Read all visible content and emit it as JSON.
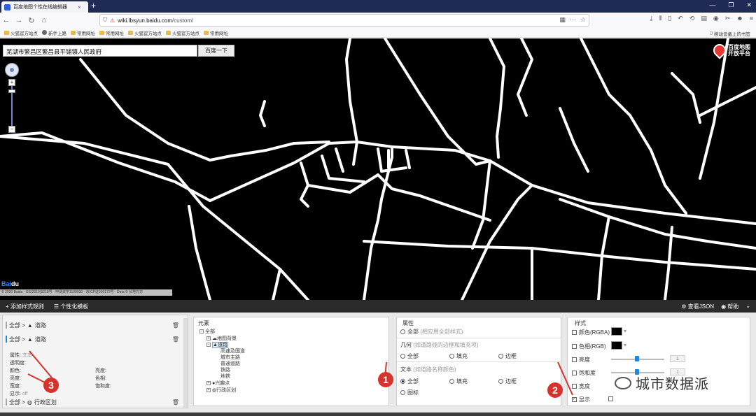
{
  "browser": {
    "tab_title": "百度地图个性在线编辑器",
    "tab_close": "×",
    "new_tab": "+",
    "url_domain": "wiki.lbsyun.baidu.com",
    "url_path": "/custom/",
    "bookmarks": [
      "火狐官方站点",
      "新手上路",
      "常用网址",
      "常用网址",
      "火狐官方站点",
      "火狐官方站点",
      "常用网址"
    ],
    "mobile_bookmarks": "移动设备上的书签"
  },
  "map": {
    "search_value": "芜湖市繁昌区繁昌县平铺镇人民政府",
    "search_button": "百度一下",
    "logo_line1": "百度地图",
    "logo_line2": "开放平台",
    "zoom_in": "+",
    "zoom_out": "−",
    "baidu_logo_a": "Bai",
    "baidu_logo_b": "du",
    "copyright": "© 2020 Baidu - GS(2019)5218号 - 甲测资字1100930 - 京ICP证030173号 - Data © 长地万方"
  },
  "toolbar": {
    "add_rule": "+ 添加样式规则",
    "template": "☰ 个性化模板",
    "view_json": "⚙ 查看JSON",
    "help": "◉ 帮助",
    "collapse": "⌄"
  },
  "rules_panel": {
    "rule1_path": "全部 > ",
    "rule1_name": "道路",
    "rule2_path": "全部 > ",
    "rule2_name": "道路",
    "rule3_path": "全部 > ",
    "rule3_name": "行政区划",
    "props_label": "属性:",
    "props_value": "文本",
    "opacity": "透明度:",
    "color": "颜色:",
    "brightness_l": "亮度:",
    "width": "宽度:",
    "display": "显示:",
    "display_value": "off",
    "brightness": "亮度:",
    "hue": "色相:",
    "saturation": "饱和度:"
  },
  "elements_panel": {
    "header": "元素",
    "root": "全部",
    "items": [
      "地图背景",
      "道路",
      "高速及国道",
      "城市主路",
      "普通道路",
      "铁路",
      "地铁",
      "兴趣点",
      "行政区划"
    ]
  },
  "attrs_panel": {
    "header": "属性",
    "all": "全部",
    "all_desc": "(相应用全部样式)",
    "geom_label": "几何",
    "geom_desc": "(如道路线的边框和填充项)",
    "geom_opts": [
      "全部",
      "填充",
      "边框"
    ],
    "text_label": "文本",
    "text_desc": "(如道路名称颜色)",
    "text_opts": [
      "全部",
      "填充",
      "边框"
    ],
    "icon": "图标"
  },
  "style_panel": {
    "header": "样式",
    "color": "颜色(RGBA)",
    "hue": "色相(RGB)",
    "brightness": "亮度",
    "saturation": "饱和度",
    "width": "宽度",
    "display": "显示",
    "brightness_value": "1",
    "saturation_value": "1",
    "swatch_color": "#000000"
  },
  "annotations": {
    "badge1": "1",
    "badge2": "2",
    "badge3": "3",
    "watermark": "城市数据派",
    "badge_color": "#d7322b"
  }
}
